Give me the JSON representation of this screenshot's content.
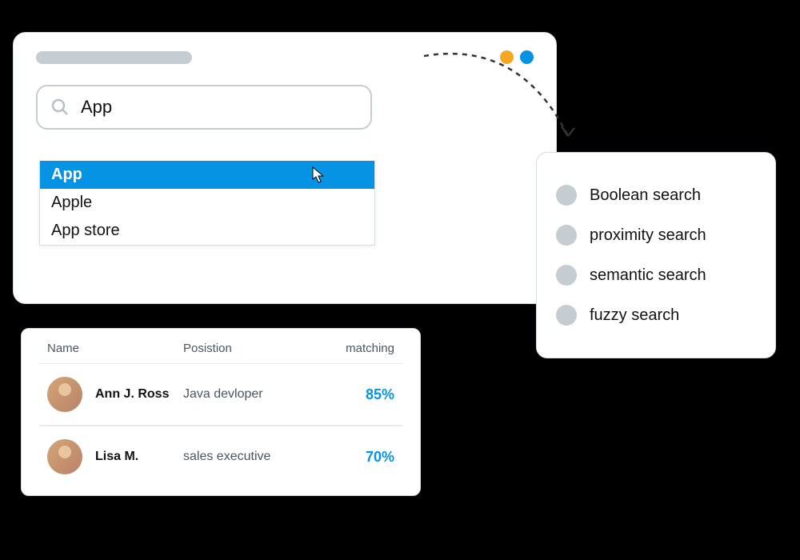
{
  "search": {
    "value": "App",
    "suggestions": [
      "App",
      "Apple",
      "App store"
    ],
    "selected_index": 0
  },
  "dots": {
    "colors": [
      "#f5a623",
      "#0693e3"
    ]
  },
  "search_types": {
    "items": [
      {
        "label": "Boolean search"
      },
      {
        "label": "proximity search"
      },
      {
        "label": "semantic search"
      },
      {
        "label": "fuzzy search"
      }
    ]
  },
  "results": {
    "columns": {
      "name": "Name",
      "position": "Posistion",
      "matching": "matching"
    },
    "rows": [
      {
        "name": "Ann J. Ross",
        "position": "Java devloper",
        "matching": "85%"
      },
      {
        "name": "Lisa M.",
        "position": "sales executive",
        "matching": "70%"
      }
    ]
  }
}
